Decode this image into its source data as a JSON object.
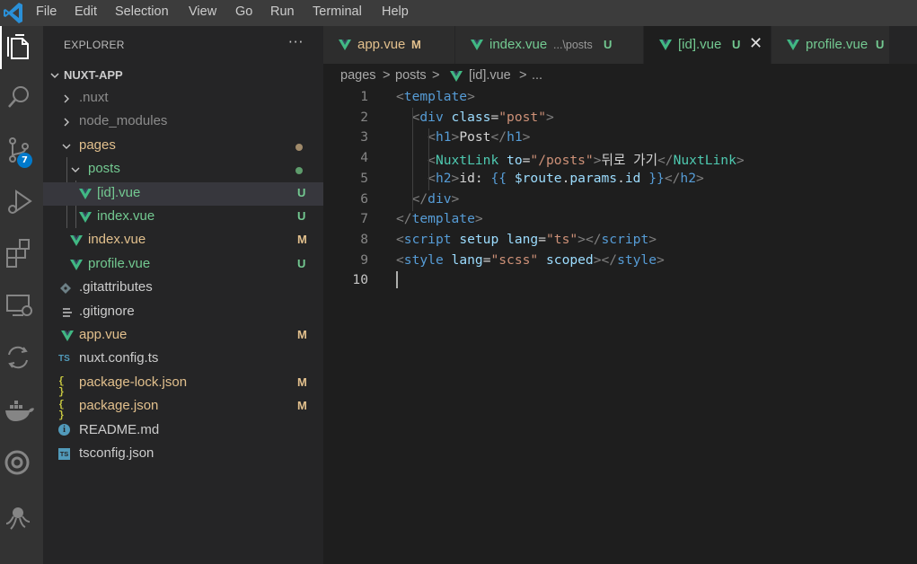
{
  "colors": {
    "vue_green": "#41b883",
    "untracked": "#73c991",
    "modified": "#e2c08d",
    "accent": "#007acc"
  },
  "menubar": {
    "logo_icon": "vscode-logo-icon",
    "items": [
      "File",
      "Edit",
      "Selection",
      "View",
      "Go",
      "Run",
      "Terminal",
      "Help"
    ]
  },
  "activity_bar": {
    "icons": [
      "explorer-icon",
      "search-icon",
      "source-control-icon",
      "run-debug-icon",
      "extensions-icon",
      "remote-explorer-icon",
      "live-share-icon",
      "docker-icon",
      "circle-extension-icon",
      "octopus-extension-icon"
    ],
    "source_control_badge": "7"
  },
  "explorer": {
    "title": "EXPLORER",
    "more": "···",
    "root": "NUXT-APP",
    "tree": [
      {
        "label": ".nuxt",
        "icon": "chevron-right-icon",
        "status": ""
      },
      {
        "label": "node_modules",
        "icon": "chevron-right-icon",
        "status": ""
      },
      {
        "label": "pages",
        "icon": "chevron-down-icon",
        "status": "modified-dot"
      },
      {
        "label": "posts",
        "icon": "chevron-down-icon",
        "status": "untracked-dot"
      },
      {
        "label": "[id].vue",
        "icon": "vue-icon",
        "status": "U"
      },
      {
        "label": "index.vue",
        "icon": "vue-icon",
        "status": "U"
      },
      {
        "label": "index.vue",
        "icon": "vue-icon",
        "status": "M"
      },
      {
        "label": "profile.vue",
        "icon": "vue-icon",
        "status": "U"
      },
      {
        "label": ".gitattributes",
        "icon": "git-icon",
        "status": ""
      },
      {
        "label": ".gitignore",
        "icon": "lines-icon",
        "status": ""
      },
      {
        "label": "app.vue",
        "icon": "vue-icon",
        "status": "M"
      },
      {
        "label": "nuxt.config.ts",
        "icon": "ts-icon",
        "icon_text": "TS",
        "status": ""
      },
      {
        "label": "package-lock.json",
        "icon": "json-icon",
        "icon_text": "{ }",
        "status": "M"
      },
      {
        "label": "package.json",
        "icon": "json-icon",
        "icon_text": "{ }",
        "status": "M"
      },
      {
        "label": "README.md",
        "icon": "info-icon",
        "icon_text": "i",
        "status": ""
      },
      {
        "label": "tsconfig.json",
        "icon": "tsconfig-icon",
        "icon_text": "TS",
        "status": ""
      }
    ]
  },
  "tabs": [
    {
      "label": "app.vue",
      "desc": "",
      "status": "M"
    },
    {
      "label": "index.vue",
      "desc": "...\\posts",
      "status": "U"
    },
    {
      "label": "[id].vue",
      "desc": "",
      "status": "U",
      "close": "✕"
    },
    {
      "label": "profile.vue",
      "desc": "",
      "status": "U"
    }
  ],
  "breadcrumb": {
    "parts": [
      "pages",
      "posts",
      "[id].vue",
      "..."
    ],
    "separator": ">"
  },
  "editor": {
    "line_numbers": [
      "1",
      "2",
      "3",
      "4",
      "5",
      "6",
      "7",
      "8",
      "9",
      "10"
    ],
    "lines": [
      [
        {
          "t": "<",
          "c": "ang"
        },
        {
          "t": "template",
          "c": "tag"
        },
        {
          "t": ">",
          "c": "ang"
        }
      ],
      [
        {
          "t": "  "
        },
        {
          "t": "<",
          "c": "ang"
        },
        {
          "t": "div",
          "c": "tag"
        },
        {
          "t": " "
        },
        {
          "t": "class",
          "c": "attr"
        },
        {
          "t": "=",
          "c": "text"
        },
        {
          "t": "\"post\"",
          "c": "str"
        },
        {
          "t": ">",
          "c": "ang"
        }
      ],
      [
        {
          "t": "    "
        },
        {
          "t": "<",
          "c": "ang"
        },
        {
          "t": "h1",
          "c": "tag"
        },
        {
          "t": ">",
          "c": "ang"
        },
        {
          "t": "Post",
          "c": "text"
        },
        {
          "t": "</",
          "c": "ang"
        },
        {
          "t": "h1",
          "c": "tag"
        },
        {
          "t": ">",
          "c": "ang"
        }
      ],
      [
        {
          "t": "    "
        },
        {
          "t": "<",
          "c": "ang"
        },
        {
          "t": "NuxtLink",
          "c": "cmp"
        },
        {
          "t": " "
        },
        {
          "t": "to",
          "c": "attr"
        },
        {
          "t": "=",
          "c": "text"
        },
        {
          "t": "\"/posts\"",
          "c": "str"
        },
        {
          "t": ">",
          "c": "ang"
        },
        {
          "t": "뒤로 가기",
          "c": "text"
        },
        {
          "t": "</",
          "c": "ang"
        },
        {
          "t": "NuxtLink",
          "c": "cmp"
        },
        {
          "t": ">",
          "c": "ang"
        }
      ],
      [
        {
          "t": "    "
        },
        {
          "t": "<",
          "c": "ang"
        },
        {
          "t": "h2",
          "c": "tag"
        },
        {
          "t": ">",
          "c": "ang"
        },
        {
          "t": "id: ",
          "c": "text"
        },
        {
          "t": "{{",
          "c": "brace"
        },
        {
          "t": " "
        },
        {
          "t": "$route",
          "c": "attr"
        },
        {
          "t": ".",
          "c": "text"
        },
        {
          "t": "params",
          "c": "attr"
        },
        {
          "t": ".",
          "c": "text"
        },
        {
          "t": "id",
          "c": "attr"
        },
        {
          "t": " "
        },
        {
          "t": "}}",
          "c": "brace"
        },
        {
          "t": "</",
          "c": "ang"
        },
        {
          "t": "h2",
          "c": "tag"
        },
        {
          "t": ">",
          "c": "ang"
        }
      ],
      [
        {
          "t": "  "
        },
        {
          "t": "</",
          "c": "ang"
        },
        {
          "t": "div",
          "c": "tag"
        },
        {
          "t": ">",
          "c": "ang"
        }
      ],
      [
        {
          "t": "</",
          "c": "ang"
        },
        {
          "t": "template",
          "c": "tag"
        },
        {
          "t": ">",
          "c": "ang"
        }
      ],
      [
        {
          "t": "<",
          "c": "ang"
        },
        {
          "t": "script",
          "c": "tag"
        },
        {
          "t": " "
        },
        {
          "t": "setup",
          "c": "attr"
        },
        {
          "t": " "
        },
        {
          "t": "lang",
          "c": "attr"
        },
        {
          "t": "=",
          "c": "text"
        },
        {
          "t": "\"ts\"",
          "c": "str"
        },
        {
          "t": "></",
          "c": "ang"
        },
        {
          "t": "script",
          "c": "tag"
        },
        {
          "t": ">",
          "c": "ang"
        }
      ],
      [
        {
          "t": "<",
          "c": "ang"
        },
        {
          "t": "style",
          "c": "tag"
        },
        {
          "t": " "
        },
        {
          "t": "lang",
          "c": "attr"
        },
        {
          "t": "=",
          "c": "text"
        },
        {
          "t": "\"scss\"",
          "c": "str"
        },
        {
          "t": " "
        },
        {
          "t": "scoped",
          "c": "attr"
        },
        {
          "t": "></",
          "c": "ang"
        },
        {
          "t": "style",
          "c": "tag"
        },
        {
          "t": ">",
          "c": "ang"
        }
      ],
      []
    ]
  }
}
